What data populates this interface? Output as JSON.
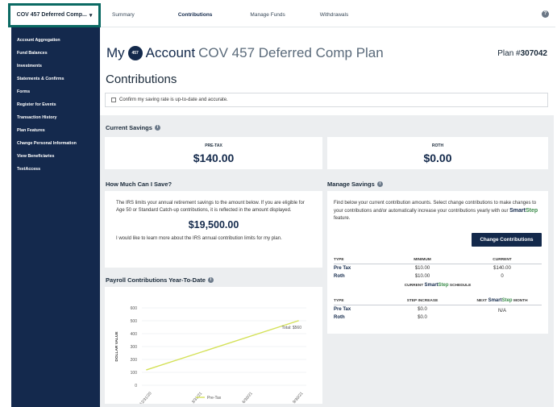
{
  "topbar": {
    "plan_selector": "COV 457 Deferred Comp...",
    "tabs": [
      "Summary",
      "Contributions",
      "Manage Funds",
      "Withdrawals"
    ],
    "active_tab": "Contributions",
    "help_label": "?"
  },
  "sidebar": {
    "items": [
      "Account Aggregation",
      "Fund Balances",
      "Investments",
      "Statements & Confirms",
      "Forms",
      "Register for Events",
      "Transaction History",
      "Plan Features",
      "Change Personal Information",
      "View Beneficiaries",
      "TextAccess"
    ]
  },
  "header": {
    "my": "My",
    "badge": "457",
    "account": "Account",
    "plan_name": "COV 457 Deferred Comp Plan",
    "plan_prefix": "Plan #",
    "plan_number": "307042",
    "section": "Contributions",
    "confirm_text": "Confirm my saving rate is up-to-date and accurate."
  },
  "current_savings": {
    "title": "Current Savings",
    "pretax_label": "PRE-TAX",
    "pretax_value": "$140.00",
    "roth_label": "ROTH",
    "roth_value": "$0.00"
  },
  "how_much": {
    "title": "How Much Can I Save?",
    "text": "The IRS limits your annual retirement savings to the amount below. If you are eligible for Age 50 or Standard Catch-up contributions, it is reflected in the amount displayed.",
    "amount": "$19,500.00",
    "learn_more": "I would like to learn more about the IRS annual contribution limits for my plan."
  },
  "manage_savings": {
    "title": "Manage Savings",
    "desc_a": "Find below your current contribution amounts. Select change contributions to make changes to your contributions and/or automatically increase your contributions yearly with our",
    "desc_smart": "Smart",
    "desc_step": "Step",
    "desc_b": "feature.",
    "button": "Change Contributions",
    "table1_headers": [
      "TYPE",
      "MINIMUM",
      "CURRENT"
    ],
    "table1_rows": [
      {
        "type": "Pre Tax",
        "minimum": "$10.00",
        "current": "$140.00"
      },
      {
        "type": "Roth",
        "minimum": "$10.00",
        "current": "0"
      }
    ],
    "schedule_prefix": "CURRENT",
    "schedule_suffix": "SCHEDULE",
    "table2_headers": [
      "TYPE",
      "STEP INCREASE",
      "NEXT",
      "MONTH"
    ],
    "table2_rows": [
      {
        "type": "Pre Tax",
        "step": "$0.0"
      },
      {
        "type": "Roth",
        "step": "$0.0"
      }
    ],
    "next_month": "N/A"
  },
  "payroll": {
    "title": "Payroll Contributions Year-To-Date"
  },
  "chart_data": {
    "type": "line",
    "title": "Payroll Contributions Year-To-Date",
    "ylabel": "DOLLAR VALUE",
    "xlabel": "",
    "x": [
      "12/31/20",
      "3/31/21",
      "6/30/21",
      "9/30/21"
    ],
    "yticks": [
      0,
      100,
      200,
      300,
      400,
      500,
      600
    ],
    "ylim": [
      0,
      600
    ],
    "grid": true,
    "legend": "bottom",
    "series": [
      {
        "name": "Pre-Tax",
        "color": "#d4e157",
        "x": [
          "12/31/20",
          "9/30/21"
        ],
        "values": [
          120,
          500
        ]
      }
    ],
    "annotation": "Total: $560"
  }
}
